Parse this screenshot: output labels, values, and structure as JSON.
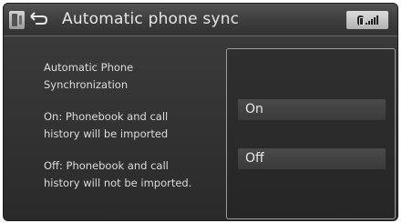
{
  "header": {
    "title": "Automatic phone sync",
    "left_icons": [
      "phone-icon",
      "back-icon"
    ],
    "status_icons": [
      "bluetooth-icon",
      "signal-strength-icon"
    ]
  },
  "description": {
    "heading_line1": "Automatic Phone",
    "heading_line2": "Synchronization",
    "on_line1": "On: Phonebook and call",
    "on_line2": "history will be imported",
    "off_line1": "Off: Phonebook and call",
    "off_line2": "history will not be imported."
  },
  "options": [
    {
      "label": "On"
    },
    {
      "label": "Off"
    }
  ]
}
